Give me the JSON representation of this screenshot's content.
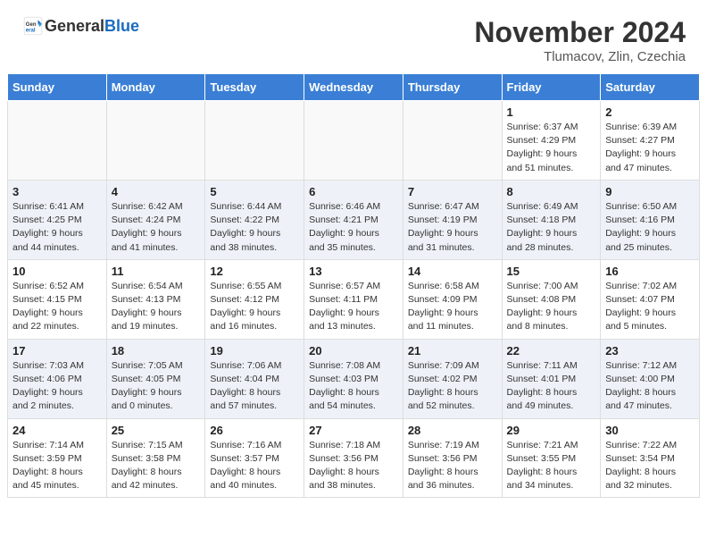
{
  "header": {
    "logo_general": "General",
    "logo_blue": "Blue",
    "title": "November 2024",
    "location": "Tlumacov, Zlin, Czechia"
  },
  "days_of_week": [
    "Sunday",
    "Monday",
    "Tuesday",
    "Wednesday",
    "Thursday",
    "Friday",
    "Saturday"
  ],
  "weeks": [
    [
      {
        "day": "",
        "detail": ""
      },
      {
        "day": "",
        "detail": ""
      },
      {
        "day": "",
        "detail": ""
      },
      {
        "day": "",
        "detail": ""
      },
      {
        "day": "",
        "detail": ""
      },
      {
        "day": "1",
        "detail": "Sunrise: 6:37 AM\nSunset: 4:29 PM\nDaylight: 9 hours\nand 51 minutes."
      },
      {
        "day": "2",
        "detail": "Sunrise: 6:39 AM\nSunset: 4:27 PM\nDaylight: 9 hours\nand 47 minutes."
      }
    ],
    [
      {
        "day": "3",
        "detail": "Sunrise: 6:41 AM\nSunset: 4:25 PM\nDaylight: 9 hours\nand 44 minutes."
      },
      {
        "day": "4",
        "detail": "Sunrise: 6:42 AM\nSunset: 4:24 PM\nDaylight: 9 hours\nand 41 minutes."
      },
      {
        "day": "5",
        "detail": "Sunrise: 6:44 AM\nSunset: 4:22 PM\nDaylight: 9 hours\nand 38 minutes."
      },
      {
        "day": "6",
        "detail": "Sunrise: 6:46 AM\nSunset: 4:21 PM\nDaylight: 9 hours\nand 35 minutes."
      },
      {
        "day": "7",
        "detail": "Sunrise: 6:47 AM\nSunset: 4:19 PM\nDaylight: 9 hours\nand 31 minutes."
      },
      {
        "day": "8",
        "detail": "Sunrise: 6:49 AM\nSunset: 4:18 PM\nDaylight: 9 hours\nand 28 minutes."
      },
      {
        "day": "9",
        "detail": "Sunrise: 6:50 AM\nSunset: 4:16 PM\nDaylight: 9 hours\nand 25 minutes."
      }
    ],
    [
      {
        "day": "10",
        "detail": "Sunrise: 6:52 AM\nSunset: 4:15 PM\nDaylight: 9 hours\nand 22 minutes."
      },
      {
        "day": "11",
        "detail": "Sunrise: 6:54 AM\nSunset: 4:13 PM\nDaylight: 9 hours\nand 19 minutes."
      },
      {
        "day": "12",
        "detail": "Sunrise: 6:55 AM\nSunset: 4:12 PM\nDaylight: 9 hours\nand 16 minutes."
      },
      {
        "day": "13",
        "detail": "Sunrise: 6:57 AM\nSunset: 4:11 PM\nDaylight: 9 hours\nand 13 minutes."
      },
      {
        "day": "14",
        "detail": "Sunrise: 6:58 AM\nSunset: 4:09 PM\nDaylight: 9 hours\nand 11 minutes."
      },
      {
        "day": "15",
        "detail": "Sunrise: 7:00 AM\nSunset: 4:08 PM\nDaylight: 9 hours\nand 8 minutes."
      },
      {
        "day": "16",
        "detail": "Sunrise: 7:02 AM\nSunset: 4:07 PM\nDaylight: 9 hours\nand 5 minutes."
      }
    ],
    [
      {
        "day": "17",
        "detail": "Sunrise: 7:03 AM\nSunset: 4:06 PM\nDaylight: 9 hours\nand 2 minutes."
      },
      {
        "day": "18",
        "detail": "Sunrise: 7:05 AM\nSunset: 4:05 PM\nDaylight: 9 hours\nand 0 minutes."
      },
      {
        "day": "19",
        "detail": "Sunrise: 7:06 AM\nSunset: 4:04 PM\nDaylight: 8 hours\nand 57 minutes."
      },
      {
        "day": "20",
        "detail": "Sunrise: 7:08 AM\nSunset: 4:03 PM\nDaylight: 8 hours\nand 54 minutes."
      },
      {
        "day": "21",
        "detail": "Sunrise: 7:09 AM\nSunset: 4:02 PM\nDaylight: 8 hours\nand 52 minutes."
      },
      {
        "day": "22",
        "detail": "Sunrise: 7:11 AM\nSunset: 4:01 PM\nDaylight: 8 hours\nand 49 minutes."
      },
      {
        "day": "23",
        "detail": "Sunrise: 7:12 AM\nSunset: 4:00 PM\nDaylight: 8 hours\nand 47 minutes."
      }
    ],
    [
      {
        "day": "24",
        "detail": "Sunrise: 7:14 AM\nSunset: 3:59 PM\nDaylight: 8 hours\nand 45 minutes."
      },
      {
        "day": "25",
        "detail": "Sunrise: 7:15 AM\nSunset: 3:58 PM\nDaylight: 8 hours\nand 42 minutes."
      },
      {
        "day": "26",
        "detail": "Sunrise: 7:16 AM\nSunset: 3:57 PM\nDaylight: 8 hours\nand 40 minutes."
      },
      {
        "day": "27",
        "detail": "Sunrise: 7:18 AM\nSunset: 3:56 PM\nDaylight: 8 hours\nand 38 minutes."
      },
      {
        "day": "28",
        "detail": "Sunrise: 7:19 AM\nSunset: 3:56 PM\nDaylight: 8 hours\nand 36 minutes."
      },
      {
        "day": "29",
        "detail": "Sunrise: 7:21 AM\nSunset: 3:55 PM\nDaylight: 8 hours\nand 34 minutes."
      },
      {
        "day": "30",
        "detail": "Sunrise: 7:22 AM\nSunset: 3:54 PM\nDaylight: 8 hours\nand 32 minutes."
      }
    ]
  ]
}
